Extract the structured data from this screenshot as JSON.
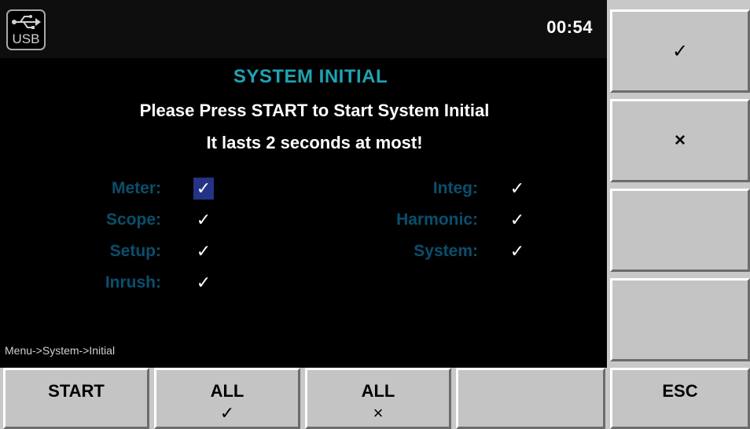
{
  "status_bar": {
    "usb_label": "USB",
    "time": "00:54"
  },
  "dialog": {
    "title": "SYSTEM INITIAL",
    "instruction": "Please Press START to Start System Initial",
    "note": "It lasts 2 seconds at most!"
  },
  "modules": {
    "meter": {
      "label": "Meter:",
      "mark": "✓",
      "selected": true
    },
    "scope": {
      "label": "Scope:",
      "mark": "✓",
      "selected": false
    },
    "setup": {
      "label": "Setup:",
      "mark": "✓",
      "selected": false
    },
    "inrush": {
      "label": "Inrush:",
      "mark": "✓",
      "selected": false
    },
    "integ": {
      "label": "Integ:",
      "mark": "✓",
      "selected": false
    },
    "harmonic": {
      "label": "Harmonic:",
      "mark": "✓",
      "selected": false
    },
    "system": {
      "label": "System:",
      "mark": "✓",
      "selected": false
    }
  },
  "breadcrumb": "Menu->System->Initial",
  "side_buttons": {
    "check": "✓",
    "cross": "×"
  },
  "bottom_buttons": {
    "start": "START",
    "all_check_label": "ALL",
    "all_check_mark": "✓",
    "all_cross_label": "ALL",
    "all_cross_mark": "×",
    "esc": "ESC"
  },
  "colors": {
    "title": "#1fa3b3",
    "module_label": "#0a4f6d",
    "selection": "#243386",
    "button_face": "#c4c4c4"
  }
}
